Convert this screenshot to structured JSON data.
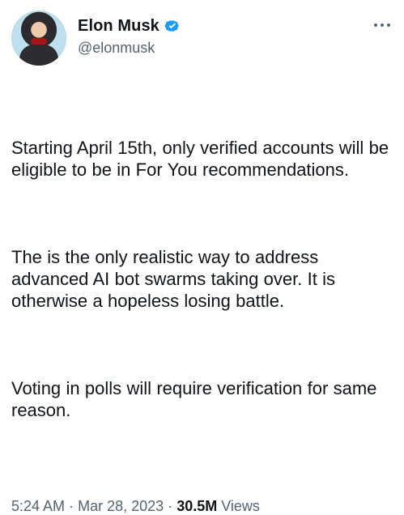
{
  "author": {
    "display_name": "Elon Musk",
    "handle": "@elonmusk",
    "avatar_icon": "profile-photo",
    "verified_icon": "verified-badge-icon",
    "verified_color": "#1d9bf0"
  },
  "tweet": {
    "paragraphs": [
      "Starting April 15th, only verified accounts will be eligible to be in For You recommendations.",
      "The is the only realistic way to address advanced AI bot swarms taking over. It is otherwise a hopeless losing battle.",
      "Voting in polls will require verification for same reason."
    ],
    "time": "5:24 AM",
    "separator_1": "·",
    "date": "Mar 28, 2023",
    "separator_2": "·",
    "views_count": "30.5M",
    "views_label": "Views",
    "more_icon": "more-horizontal-icon"
  },
  "colors": {
    "text": "#0f1419",
    "secondary_text": "#536471",
    "background": "#ffffff"
  }
}
